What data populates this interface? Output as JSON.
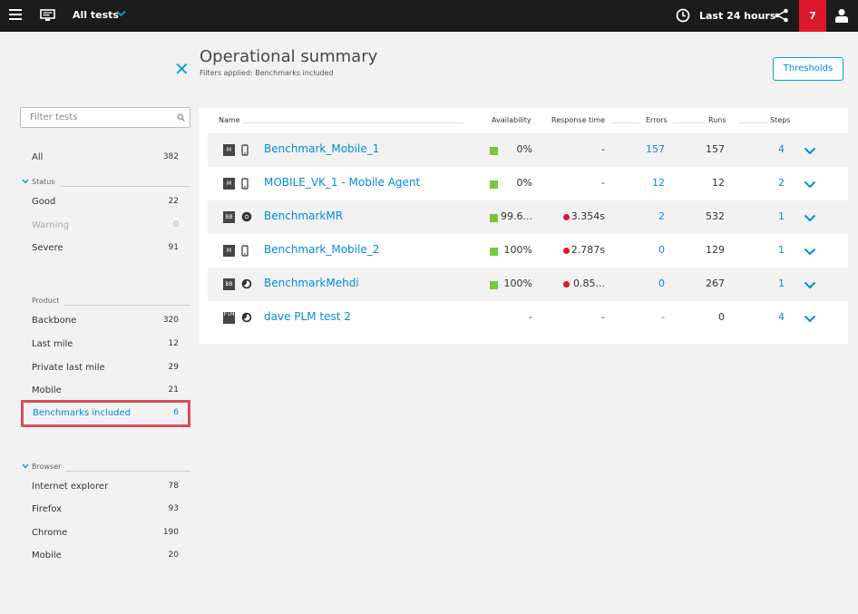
{
  "header": {
    "title": "All tests",
    "timeframe": "Last 24 hours",
    "notification_count": "7"
  },
  "page": {
    "title": "Operational summary",
    "filters_applied": "Filters applied: Benchmarks included",
    "thresholds_label": "Thresholds"
  },
  "sidebar": {
    "filter_placeholder": "Filter tests",
    "all": {
      "label": "All",
      "count": "382"
    },
    "status": {
      "header": "Status",
      "items": [
        {
          "label": "Good",
          "count": "22"
        },
        {
          "label": "Warning",
          "count": "0"
        },
        {
          "label": "Severe",
          "count": "91"
        }
      ]
    },
    "product": {
      "header": "Product",
      "items": [
        {
          "label": "Backbone",
          "count": "320"
        },
        {
          "label": "Last mile",
          "count": "12"
        },
        {
          "label": "Private last mile",
          "count": "29"
        },
        {
          "label": "Mobile",
          "count": "21"
        },
        {
          "label": "Benchmarks included",
          "count": "6"
        }
      ]
    },
    "browser": {
      "header": "Browser",
      "items": [
        {
          "label": "Internet explorer",
          "count": "78"
        },
        {
          "label": "Firefox",
          "count": "93"
        },
        {
          "label": "Chrome",
          "count": "190"
        },
        {
          "label": "Mobile",
          "count": "20"
        }
      ]
    }
  },
  "table": {
    "columns": {
      "name": "Name",
      "availability": "Availability",
      "response_time": "Response time",
      "errors": "Errors",
      "runs": "Runs",
      "steps": "Steps"
    },
    "rows": [
      {
        "badge": "M",
        "type_icon": "mobile-device-icon",
        "name": "Benchmark_Mobile_1",
        "availability": "0%",
        "response_time": "-",
        "errors": "157",
        "runs": "157",
        "steps": "4"
      },
      {
        "badge": "M",
        "type_icon": "mobile-device-icon",
        "name": "MOBILE_VK_1 - Mobile Agent",
        "availability": "0%",
        "response_time": "-",
        "errors": "12",
        "runs": "12",
        "steps": "2"
      },
      {
        "badge": "BB",
        "type_icon": "chrome-icon",
        "name": "BenchmarkMR",
        "availability": "99.6...",
        "response_time": "3.354s",
        "errors": "2",
        "runs": "532",
        "steps": "1"
      },
      {
        "badge": "M",
        "type_icon": "mobile-device-icon",
        "name": "Benchmark_Mobile_2",
        "availability": "100%",
        "response_time": "2.787s",
        "errors": "0",
        "runs": "129",
        "steps": "1"
      },
      {
        "badge": "BB",
        "type_icon": "firefox-icon",
        "name": "BenchmarkMehdi",
        "availability": "100%",
        "response_time": "0.85...",
        "errors": "0",
        "runs": "267",
        "steps": "1"
      },
      {
        "badge": "P LM",
        "type_icon": "firefox-icon",
        "name": "dave PLM test 2",
        "availability": "-",
        "response_time": "-",
        "errors": "-",
        "runs": "0",
        "steps": "4"
      }
    ]
  },
  "colors": {
    "accent": "#008cdb",
    "good": "#7dc540",
    "severe": "#dc172a",
    "topbar": "#1b1b1b",
    "highlight_border": "#dc4c5b"
  }
}
